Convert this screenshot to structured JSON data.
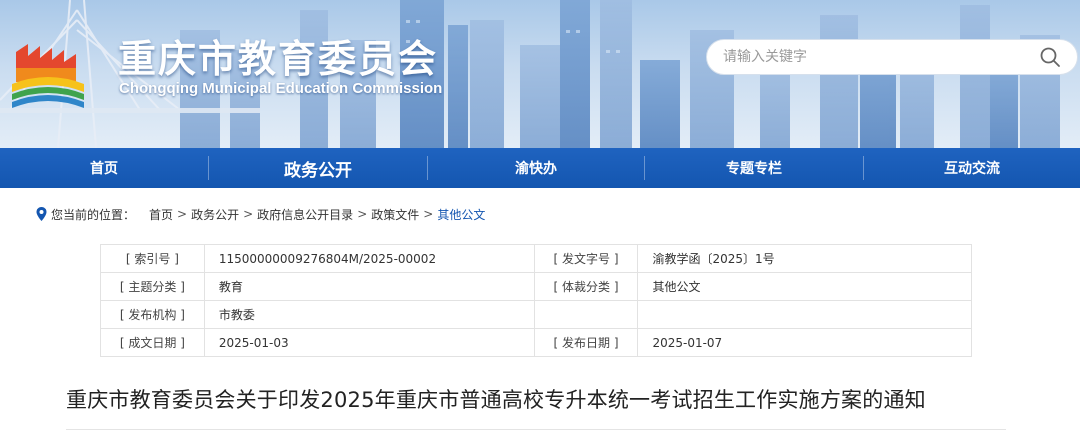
{
  "header": {
    "title": "重庆市教育委员会",
    "subtitle": "Chongqing Municipal Education Commission",
    "search": {
      "placeholder": "请输入关键字",
      "value": ""
    }
  },
  "nav": {
    "items": [
      {
        "label": "首页",
        "active": false
      },
      {
        "label": "政务公开",
        "active": true
      },
      {
        "label": "渝快办",
        "active": false
      },
      {
        "label": "专题专栏",
        "active": false
      },
      {
        "label": "互动交流",
        "active": false
      }
    ]
  },
  "breadcrumb": {
    "prefix": "您当前的位置：",
    "separator": ">",
    "items": [
      "首页",
      "政务公开",
      "政府信息公开目录",
      "政策文件",
      "其他公文"
    ]
  },
  "meta": {
    "rows": [
      {
        "label1": "[ 索引号 ]",
        "value1": "11500000009276804M/2025-00002",
        "label2": "[ 发文字号 ]",
        "value2": "渝教学函〔2025〕1号"
      },
      {
        "label1": "[ 主题分类 ]",
        "value1": "教育",
        "label2": "[ 体裁分类 ]",
        "value2": "其他公文"
      },
      {
        "label1": "[ 发布机构 ]",
        "value1": "市教委",
        "label2": "",
        "value2": ""
      },
      {
        "label1": "[ 成文日期 ]",
        "value1": "2025-01-03",
        "label2": "[ 发布日期 ]",
        "value2": "2025-01-07"
      }
    ]
  },
  "article": {
    "title": "重庆市教育委员会关于印发2025年重庆市普通高校专升本统一考试招生工作实施方案的通知"
  },
  "colors": {
    "nav_blue": "#1456b0",
    "breadcrumb_current": "#1456b0"
  },
  "icons": {
    "search": "search-icon",
    "location": "location-pin-icon",
    "logo": "emblem-logo-icon"
  }
}
